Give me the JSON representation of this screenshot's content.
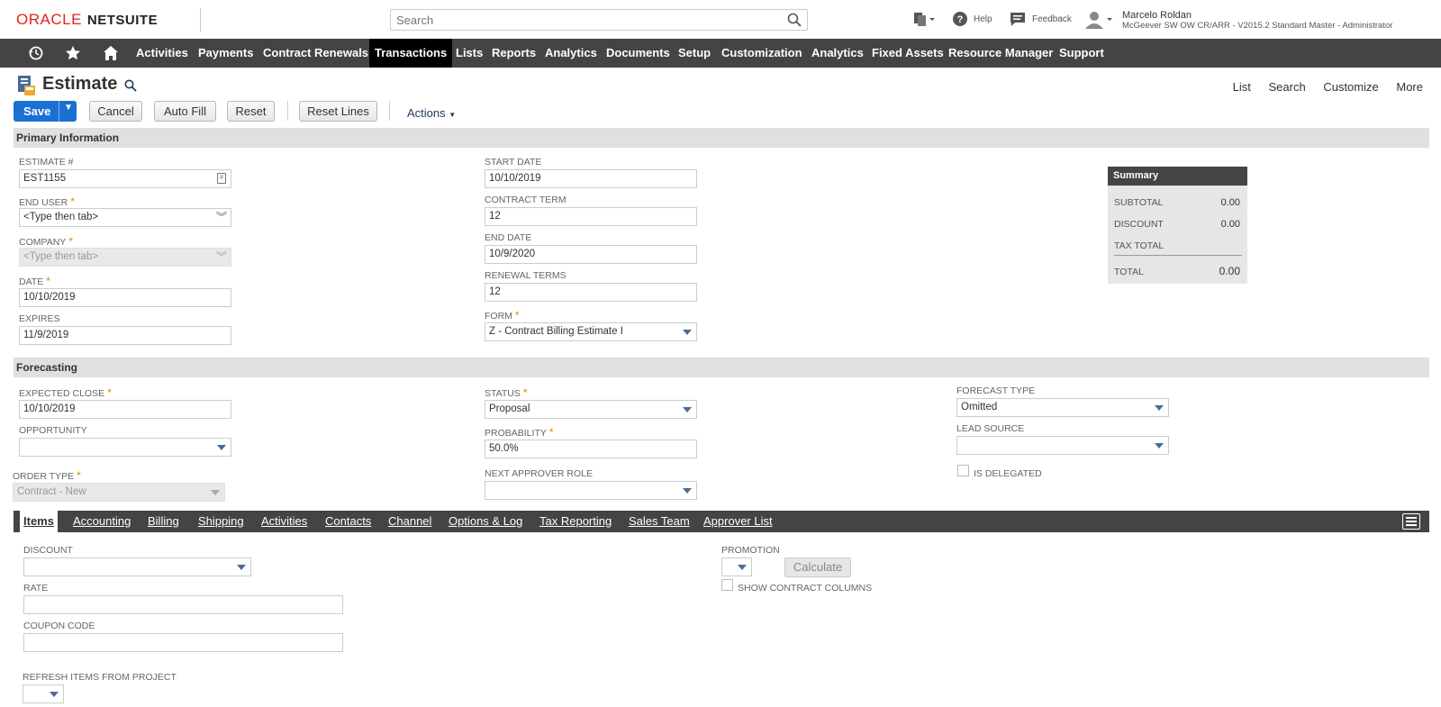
{
  "header": {
    "logo_oracle": "ORACLE",
    "logo_netsuite": "NETSUITE",
    "search_placeholder": "Search",
    "help": "Help",
    "feedback": "Feedback",
    "user_name": "Marcelo Roldan",
    "user_role": "McGeever SW OW CR/ARR - V2015.2 Standard Master - Administrator"
  },
  "nav": {
    "items": [
      "Activities",
      "Payments",
      "Contract Renewals",
      "Transactions",
      "Lists",
      "Reports",
      "Analytics",
      "Documents",
      "Setup",
      "Customization",
      "Analytics",
      "Fixed Assets",
      "Resource Manager",
      "Support"
    ],
    "active": "Transactions"
  },
  "page": {
    "title": "Estimate",
    "links": [
      "List",
      "Search",
      "Customize",
      "More"
    ]
  },
  "toolbar": {
    "save": "Save",
    "cancel": "Cancel",
    "autofill": "Auto Fill",
    "reset": "Reset",
    "reset_lines": "Reset Lines",
    "actions": "Actions"
  },
  "primary": {
    "section_title": "Primary Information",
    "estimate_label": "ESTIMATE #",
    "estimate_value": "EST1155",
    "end_user_label": "END USER",
    "end_user_value": "<Type then tab>",
    "company_label": "COMPANY",
    "company_value": "<Type then tab>",
    "date_label": "DATE",
    "date_value": "10/10/2019",
    "expires_label": "EXPIRES",
    "expires_value": "11/9/2019",
    "start_date_label": "START DATE",
    "start_date_value": "10/10/2019",
    "contract_term_label": "CONTRACT TERM",
    "contract_term_value": "12",
    "end_date_label": "END DATE",
    "end_date_value": "10/9/2020",
    "renewal_terms_label": "RENEWAL TERMS",
    "renewal_terms_value": "12",
    "form_label": "FORM",
    "form_value": "Z - Contract Billing Estimate I"
  },
  "summary": {
    "title": "Summary",
    "subtotal_label": "SUBTOTAL",
    "subtotal_value": "0.00",
    "discount_label": "DISCOUNT",
    "discount_value": "0.00",
    "tax_label": "TAX TOTAL",
    "total_label": "TOTAL",
    "total_value": "0.00"
  },
  "forecasting": {
    "section_title": "Forecasting",
    "expected_close_label": "EXPECTED CLOSE",
    "expected_close_value": "10/10/2019",
    "opportunity_label": "OPPORTUNITY",
    "order_type_label": "ORDER TYPE",
    "order_type_value": "Contract - New",
    "status_label": "STATUS",
    "status_value": "Proposal",
    "probability_label": "PROBABILITY",
    "probability_value": "50.0%",
    "next_approver_label": "NEXT APPROVER ROLE",
    "forecast_type_label": "FORECAST TYPE",
    "forecast_type_value": "Omitted",
    "lead_source_label": "LEAD SOURCE",
    "is_delegated_label": "IS DELEGATED"
  },
  "subtabs": {
    "items": [
      "Items",
      "Accounting",
      "Billing",
      "Shipping",
      "Activities",
      "Contacts",
      "Channel",
      "Options & Log",
      "Tax Reporting",
      "Sales Team",
      "Approver List"
    ],
    "active": "Items"
  },
  "items_tab": {
    "discount_label": "DISCOUNT",
    "rate_label": "RATE",
    "coupon_label": "COUPON CODE",
    "refresh_label": "REFRESH ITEMS FROM PROJECT",
    "promotion_label": "PROMOTION",
    "calculate": "Calculate",
    "show_contract_label": "SHOW CONTRACT COLUMNS"
  }
}
